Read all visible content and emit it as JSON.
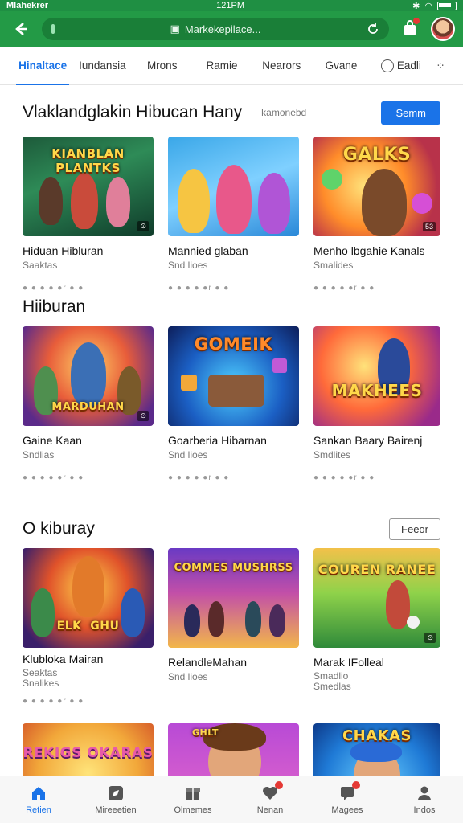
{
  "status": {
    "carrier": "Mlahekrer",
    "time": "121PM"
  },
  "address_bar": {
    "text": "Markekepilace..."
  },
  "tabs": [
    {
      "label": "Hinaltace",
      "active": true
    },
    {
      "label": "Iundansia"
    },
    {
      "label": "Mrons"
    },
    {
      "label": "Ramie"
    },
    {
      "label": "Nearors"
    },
    {
      "label": "Gvane"
    },
    {
      "label": "Eadli"
    }
  ],
  "sections": [
    {
      "title": "Vlaklandglakin Hibucan Hany",
      "subtitle": "kamonebd",
      "action": "Semm",
      "cards": [
        {
          "title": "Hiduan Hibluran",
          "sub": "Saaktas",
          "meta": "● ● ● ● ●r   ● ●"
        },
        {
          "title": "Mannied glaban",
          "sub": "Snd lioes",
          "meta": "● ● ● ● ●r   ● ●"
        },
        {
          "title": "Menho lbgahie Kanals",
          "sub": "Smalides",
          "meta": "● ● ● ● ●r   ● ●"
        }
      ]
    },
    {
      "title": "Hiiburan",
      "subtitle": "",
      "action": "",
      "cards": [
        {
          "title": "Gaine Kaan",
          "sub": "Sndlias",
          "meta": "● ● ● ● ●r   ● ●"
        },
        {
          "title": "Goarberia Hibarnan",
          "sub": "Snd lioes",
          "meta": "● ● ● ● ●r   ● ●"
        },
        {
          "title": "Sankan Baary Bairenj",
          "sub": "Smdlites",
          "meta": "● ● ● ● ●r   ● ●"
        }
      ]
    },
    {
      "title": "O kiburay",
      "subtitle": "",
      "action": "Feeor",
      "cards": [
        {
          "title": "Klubloka Mairan",
          "sub": "Seaktas\nSnalikes",
          "meta": "● ● ● ● ●r   ● ●"
        },
        {
          "title": "RelandleMahan",
          "sub": "Snd lioes",
          "meta": ""
        },
        {
          "title": "Marak IFolleal",
          "sub": "Smadlio\nSmedlas",
          "meta": ""
        }
      ]
    }
  ],
  "thumb_text": [
    "KIANBLAN PLANTKS",
    "",
    "GALKS",
    "MARDUHAN",
    "GOMEIK",
    "MAKHEES",
    "",
    "COMMES MUSHRSS",
    "COUREN RANEE",
    "REKIGS OKARAS",
    "",
    "CHAKAS"
  ],
  "bottom_nav": [
    {
      "label": "Retien",
      "icon": "home-icon",
      "active": true
    },
    {
      "label": "Mireeetien",
      "icon": "compass-icon"
    },
    {
      "label": "Olmemes",
      "icon": "gift-icon"
    },
    {
      "label": "Nenan",
      "icon": "heart-icon",
      "badge": true
    },
    {
      "label": "Magees",
      "icon": "chat-icon",
      "badge": true
    },
    {
      "label": "Indos",
      "icon": "user-icon"
    }
  ],
  "colors": {
    "brand_green": "#239a46",
    "accent_blue": "#1a73e8"
  }
}
